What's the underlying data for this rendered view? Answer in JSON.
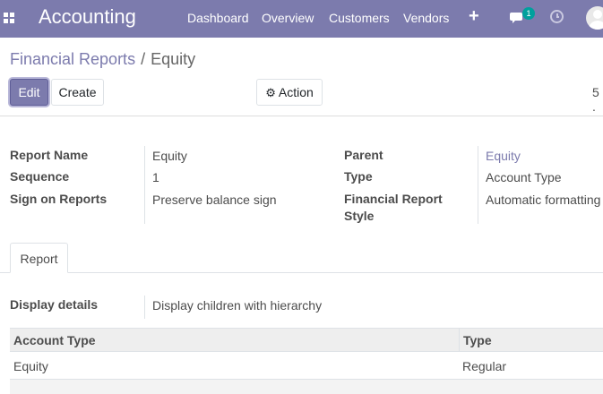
{
  "navbar": {
    "app_title": "Accounting",
    "menu": [
      "Dashboard",
      "Overview",
      "Customers",
      "Vendors"
    ],
    "plus": "+",
    "chat_badge": "1",
    "icons": [
      "apps-grid-icon",
      "plus-icon",
      "chat-icon",
      "clock-icon",
      "user-avatar"
    ]
  },
  "breadcrumb": {
    "parent": "Financial Reports",
    "separator": "/",
    "current": "Equity"
  },
  "toolbar": {
    "edit": "Edit",
    "create": "Create",
    "action": "Action",
    "pager": "5 ."
  },
  "form": {
    "report_name_label": "Report Name",
    "report_name": "Equity",
    "sequence_label": "Sequence",
    "sequence": "1",
    "sign_label": "Sign on Reports",
    "sign": "Preserve balance sign",
    "parent_label": "Parent",
    "parent": "Equity",
    "type_label": "Type",
    "type": "Account Type",
    "style_label_1": "Financial Report",
    "style_label_2": "Style",
    "style": "Automatic formatting"
  },
  "tabs": [
    {
      "label": "Report"
    }
  ],
  "report": {
    "display_label": "Display details",
    "display_value": "Display children with hierarchy",
    "columns": [
      "Account Type",
      "Type"
    ],
    "rows": [
      {
        "account_type": "Equity",
        "type": "Regular"
      }
    ]
  },
  "colors": {
    "brand": "#7c7bad",
    "badge": "#00a09d"
  }
}
